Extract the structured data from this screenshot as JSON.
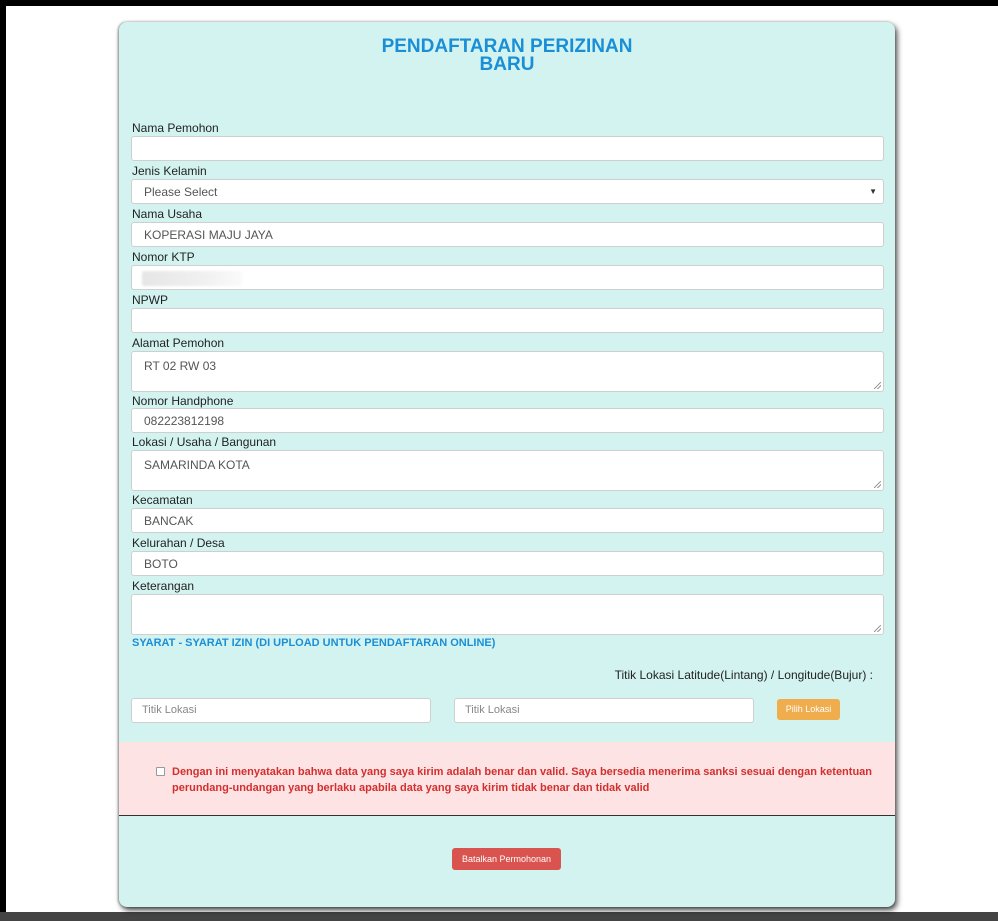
{
  "form": {
    "title_line1": "PENDAFTARAN PERIZINAN",
    "title_line2": "BARU",
    "fields": {
      "nama_pemohon": {
        "label": "Nama Pemohon",
        "value": ""
      },
      "jenis_kelamin": {
        "label": "Jenis Kelamin",
        "value": "Please Select"
      },
      "nama_usaha": {
        "label": "Nama Usaha",
        "value": "KOPERASI MAJU JAYA"
      },
      "nomor_ktp": {
        "label": "Nomor KTP",
        "value": ""
      },
      "npwp": {
        "label": "NPWP",
        "value": ""
      },
      "alamat_pemohon": {
        "label": "Alamat Pemohon",
        "value": "RT 02 RW 03"
      },
      "nomor_handphone": {
        "label": "Nomor Handphone",
        "value": "082223812198"
      },
      "lokasi": {
        "label": "Lokasi / Usaha / Bangunan",
        "value": "SAMARINDA KOTA"
      },
      "kecamatan": {
        "label": "Kecamatan",
        "value": "BANCAK"
      },
      "kelurahan": {
        "label": "Kelurahan / Desa",
        "value": "BOTO"
      },
      "keterangan": {
        "label": "Keterangan",
        "value": ""
      }
    },
    "syarat_heading": "SYARAT - SYARAT IZIN (DI UPLOAD UNTUK PENDAFTARAN ONLINE)",
    "titik_label": "Titik Lokasi Latitude(Lintang) / Longitude(Bujur) :",
    "latitude_placeholder": "Titik Lokasi",
    "longitude_placeholder": "Titik Lokasi",
    "pilih_lokasi_label": "Pilih Lokasi",
    "declaration": "Dengan ini menyatakan bahwa data yang saya kirim adalah benar dan valid. Saya bersedia menerima sanksi sesuai dengan ketentuan perundang-undangan yang berlaku apabila data yang saya kirim tidak benar dan tidak valid",
    "cancel_label": "Batalkan Permohonan"
  },
  "colors": {
    "card_bg": "#d3f3f1",
    "title": "#1a8fd6",
    "declaration_bg": "#fde3e3",
    "declaration_text": "#d32f2f",
    "pilih_button": "#f0ad4e",
    "cancel_button": "#d9534f"
  },
  "icons": {
    "select_arrow": "chevron-down-icon",
    "checkbox": "checkbox-icon"
  }
}
